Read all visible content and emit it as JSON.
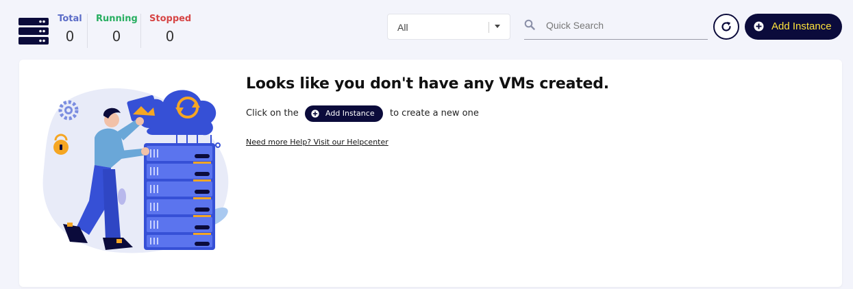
{
  "stats": {
    "total_label": "Total",
    "total_value": "0",
    "running_label": "Running",
    "running_value": "0",
    "stopped_label": "Stopped",
    "stopped_value": "0"
  },
  "filter": {
    "selected": "All"
  },
  "search": {
    "placeholder": "Quick Search",
    "value": ""
  },
  "toolbar": {
    "add_label": "Add Instance",
    "refresh_icon": "refresh-icon"
  },
  "empty_state": {
    "headline": "Looks like you don't have any VMs created.",
    "message_before": "Click on the",
    "inline_button_label": "Add Instance",
    "message_after": "to create a new one",
    "help_link": "Need more Help? Visit our Helpcenter"
  },
  "colors": {
    "brand_dark": "#0b0b3b",
    "accent_yellow": "#ffe33b",
    "total": "#5b6cc7",
    "running": "#27ae60",
    "stopped": "#d64545"
  }
}
